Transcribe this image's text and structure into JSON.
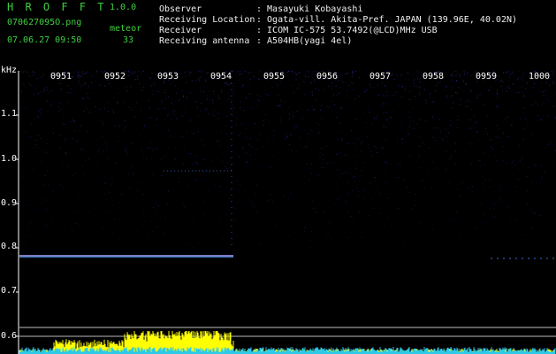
{
  "app": {
    "title": "H R O F F T",
    "version": "1.0.0"
  },
  "file_name": "070627095O.png",
  "meteor_label": "meteor",
  "datetime": "07.06.27 09:50",
  "meteor_count": "33",
  "info": [
    {
      "key": "Observer",
      "value": ": Masayuki Kobayashi"
    },
    {
      "key": "Receiving Location",
      "value": ": Ogata-vill. Akita-Pref. JAPAN (139.96E, 40.02N)"
    },
    {
      "key": "Receiver",
      "value": ": ICOM IC-575 53.7492(@LCD)MHz USB"
    },
    {
      "key": "Receiving antenna",
      "value": ": A504HB(yagi 4el)"
    }
  ],
  "spectrogram": {
    "unit": "kHz",
    "time_ticks": [
      "0951",
      "0952",
      "0953",
      "0954",
      "0955",
      "0956",
      "0957",
      "0958",
      "0959",
      "1000"
    ],
    "freq_ticks": [
      "1.1",
      "1.0",
      "0.9",
      "0.8",
      "0.7",
      "0.6"
    ],
    "colors": {
      "background": "#000000",
      "noise": "#2a2a9a",
      "echo": "#ff4fb0",
      "carrier": "#4fd0ff",
      "level_fill": "#ffff00",
      "level_base": "#2fc9e8"
    }
  }
}
